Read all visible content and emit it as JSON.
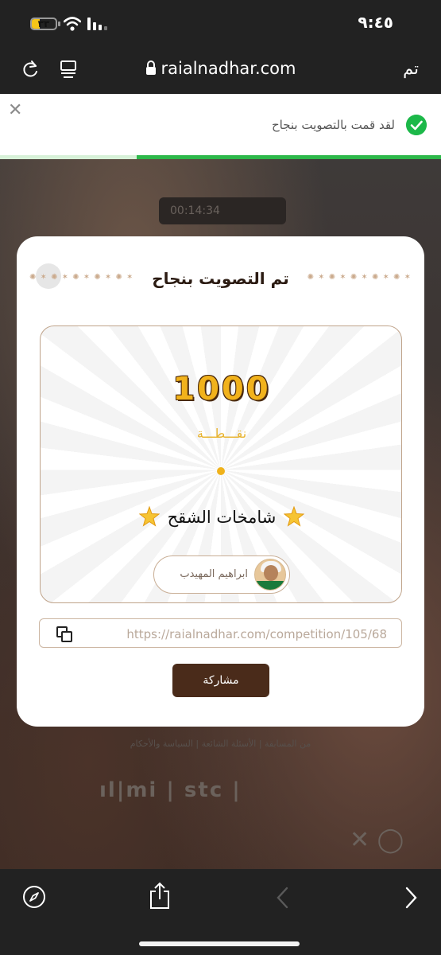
{
  "status_bar": {
    "time": "٩:٤٥",
    "battery_level": "٣٣",
    "battery_percent": 33
  },
  "browser": {
    "domain": "raialnadhar.com",
    "done_label": "تم"
  },
  "toast": {
    "message": "لقد قمت بالتصويت بنجاح",
    "progress_percent": 69
  },
  "background_page": {
    "timer": "00:14:34",
    "footer_links": "من المسابقة  |  الأسئلة الشائعة  |  السياسة والأحكام",
    "sponsor_text": "ıl|mi  |  stc  |",
    "social_icons": "✕  ◯"
  },
  "modal": {
    "title": "تم التصويت بنجاح",
    "ornament": "✺ ✶ ✺ ✶ ✺ ✶ ✺ ✶ ✺ ✶",
    "points_value": "1000",
    "points_unit": "نقـــطـــة",
    "team_name": "شامخات الشقح",
    "user_name": "ابراهيم المهيدب",
    "share_url": "https://raialnadhar.com/competition/105/68",
    "share_button": "مشاركة"
  },
  "colors": {
    "accent_gold": "#f1b21c",
    "brown": "#4a2b1a",
    "success_green": "#1cb849"
  }
}
